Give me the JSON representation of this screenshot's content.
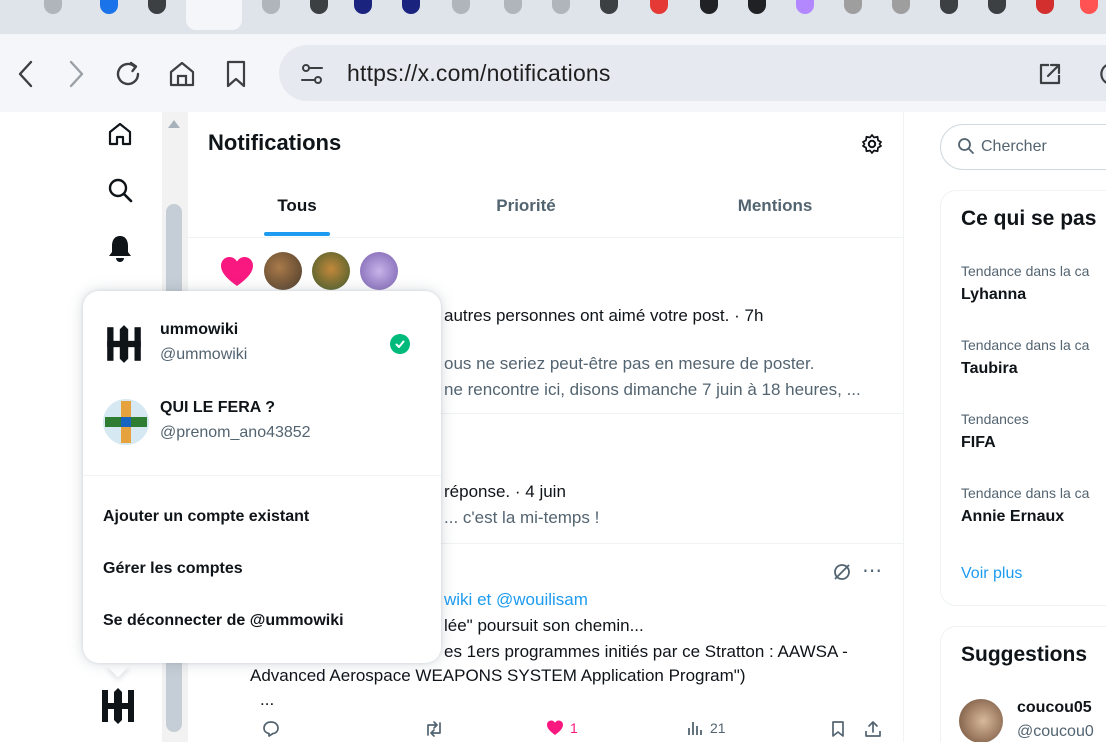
{
  "browser": {
    "url": "https://x.com/notifications"
  },
  "main": {
    "title": "Notifications",
    "tabs": [
      {
        "label": "Tous"
      },
      {
        "label": "Priorité"
      },
      {
        "label": "Mentions"
      }
    ],
    "notif1": {
      "line1": "autres personnes ont aimé votre post. · 7h",
      "line2": "ous ne seriez peut-être pas en mesure de poster.",
      "line3": "ne rencontre ici, disons dimanche 7 juin à 18 heures, ..."
    },
    "notif2": {
      "line1": "réponse. · 4 juin",
      "line2": "... c'est la mi-temps !"
    },
    "notif3": {
      "mention_a": "wiki",
      "conj": "et",
      "mention_b": "@wouilisam",
      "line2": "lée\" poursuit son chemin...",
      "line3": "es 1ers programmes initiés par ce Stratton : AAWSA -",
      "line4": "Advanced Aerospace WEAPONS SYSTEM Application Program\")",
      "line5": "...",
      "likes": "1",
      "views": "21"
    }
  },
  "right": {
    "search_placeholder": "Chercher",
    "trends_title": "Ce qui se pas",
    "trends": [
      {
        "meta": "Tendance dans la ca",
        "name": "Lyhanna"
      },
      {
        "meta": "Tendance dans la ca",
        "name": "Taubira"
      },
      {
        "meta": "Tendances",
        "name": "FIFA"
      },
      {
        "meta": "Tendance dans la ca",
        "name": "Annie Ernaux"
      }
    ],
    "more": "Voir plus",
    "suggestions_title": "Suggestions",
    "suggestion": {
      "name": "coucou05",
      "handle": "@coucou0"
    }
  },
  "account_menu": {
    "accounts": [
      {
        "name": "ummowiki",
        "handle": "@ummowiki"
      },
      {
        "name": "QUI LE FERA ?",
        "handle": "@prenom_ano43852"
      }
    ],
    "add_existing": "Ajouter un compte existant",
    "manage": "Gérer les comptes",
    "logout": "Se déconnecter de @ummowiki"
  },
  "colors": {
    "accent": "#1d9bf0",
    "like": "#f91880",
    "verified": "#00ba7c",
    "text": "#0f1419",
    "muted": "#536471"
  }
}
